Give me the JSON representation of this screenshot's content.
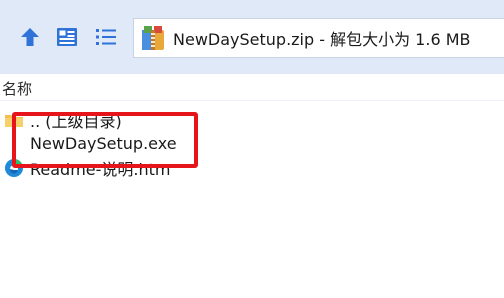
{
  "toolbar": {
    "up_icon": "up-arrow-icon",
    "view_icon": "view-toggle-icon",
    "list_icon": "list-view-icon",
    "address_icon": "zip-archive-icon",
    "address_text": "NewDaySetup.zip - 解包大小为 1.6 MB"
  },
  "list": {
    "column_header": "名称",
    "rows": [
      {
        "label": ".. (上级目录)",
        "icon": "folder-icon"
      },
      {
        "label": "NewDaySetup.exe",
        "icon": "application-icon"
      },
      {
        "label": "Readme-说明.htm",
        "icon": "edge-browser-icon"
      }
    ]
  },
  "colors": {
    "toolbar_bg": "#dfe9f8",
    "accent_blue": "#2f73d8",
    "highlight_red": "#e8141b"
  }
}
